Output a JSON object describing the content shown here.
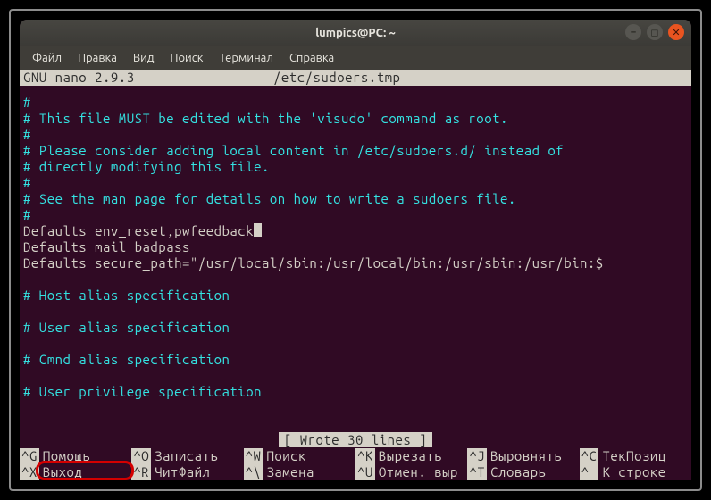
{
  "titlebar": {
    "title": "lumpics@PC: ~"
  },
  "menubar": {
    "items": [
      "Файл",
      "Правка",
      "Вид",
      "Поиск",
      "Терминал",
      "Справка"
    ]
  },
  "status": {
    "version": "  GNU  nano  2.9.3",
    "file": "/etc/sudoers.tmp"
  },
  "lines": {
    "l0": "#",
    "l1": "# This file MUST be edited with the 'visudo' command as root.",
    "l2": "#",
    "l3": "# Please consider adding local content in /etc/sudoers.d/ instead of",
    "l4": "# directly modifying this file.",
    "l5": "#",
    "l6": "# See the man page for details on how to write a sudoers file.",
    "l7": "#",
    "d0": "Defaults env_reset,pwfeedback",
    "d1": "Defaults        mail_badpass",
    "d2": "Defaults        secure_path=\"/usr/local/sbin:/usr/local/bin:/usr/sbin:/usr/bin:$",
    "h0": "# Host alias specification",
    "h1": "# User alias specification",
    "h2": "# Cmnd alias specification",
    "h3": "# User privilege specification"
  },
  "message": "[ Wrote 30 lines ]",
  "shortcuts": {
    "row1": [
      {
        "key": "^G",
        "label": "Помощь"
      },
      {
        "key": "^O",
        "label": "Записать"
      },
      {
        "key": "^W",
        "label": "Поиск"
      },
      {
        "key": "^K",
        "label": "Вырезать"
      },
      {
        "key": "^J",
        "label": "Выровнять"
      },
      {
        "key": "^C",
        "label": "ТекПозиц"
      }
    ],
    "row2": [
      {
        "key": "^X",
        "label": "Выход"
      },
      {
        "key": "^R",
        "label": "ЧитФайл"
      },
      {
        "key": "^\\",
        "label": "Замена"
      },
      {
        "key": "^U",
        "label": "Отмен. выр"
      },
      {
        "key": "^T",
        "label": "Словарь"
      },
      {
        "key": "^_",
        "label": "К строке"
      }
    ]
  }
}
